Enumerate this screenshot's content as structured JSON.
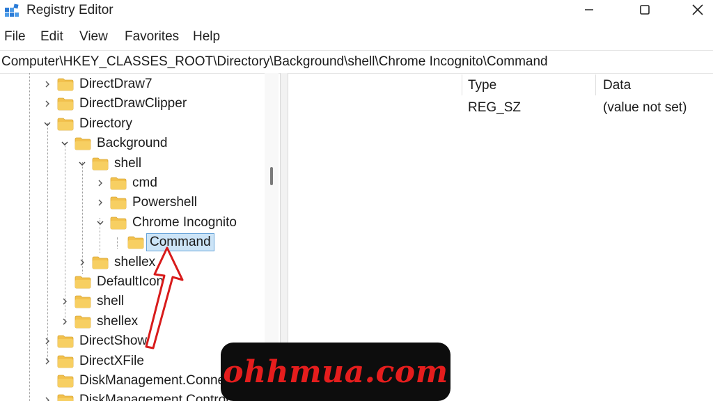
{
  "window": {
    "title": "Registry Editor"
  },
  "menu": [
    "File",
    "Edit",
    "View",
    "Favorites",
    "Help"
  ],
  "address": "Computer\\HKEY_CLASSES_ROOT\\Directory\\Background\\shell\\Chrome Incognito\\Command",
  "tree": [
    {
      "label": "DirectDraw7",
      "state": "collapsed",
      "selected": false
    },
    {
      "label": "DirectDrawClipper",
      "state": "collapsed",
      "selected": false
    },
    {
      "label": "Directory",
      "state": "expanded",
      "selected": false
    },
    {
      "label": "Background",
      "state": "expanded",
      "selected": false
    },
    {
      "label": "shell",
      "state": "expanded",
      "selected": false
    },
    {
      "label": "cmd",
      "state": "collapsed",
      "selected": false
    },
    {
      "label": "Powershell",
      "state": "collapsed",
      "selected": false
    },
    {
      "label": "Chrome Incognito",
      "state": "expanded",
      "selected": false
    },
    {
      "label": "Command",
      "state": "leaf",
      "selected": true
    },
    {
      "label": "shellex",
      "state": "collapsed",
      "selected": false
    },
    {
      "label": "DefaultIcon",
      "state": "leaf",
      "selected": false
    },
    {
      "label": "shell",
      "state": "collapsed",
      "selected": false
    },
    {
      "label": "shellex",
      "state": "collapsed",
      "selected": false
    },
    {
      "label": "DirectShow",
      "state": "collapsed",
      "selected": false
    },
    {
      "label": "DirectXFile",
      "state": "collapsed",
      "selected": false
    },
    {
      "label": "DiskManagement.Conne",
      "state": "leaf",
      "selected": false
    },
    {
      "label": "DiskManagement.Control",
      "state": "collapsed",
      "selected": false
    }
  ],
  "list": {
    "columns": [
      "Type",
      "Data"
    ],
    "rows": [
      {
        "type": "REG_SZ",
        "data": "(value not set)"
      }
    ]
  },
  "watermark": "ohhmua.com",
  "colors": {
    "folder": "#f2c14e",
    "selection": "#cce4f7",
    "arrow": "#d81b1b",
    "watermark_text": "#e51d1d"
  }
}
